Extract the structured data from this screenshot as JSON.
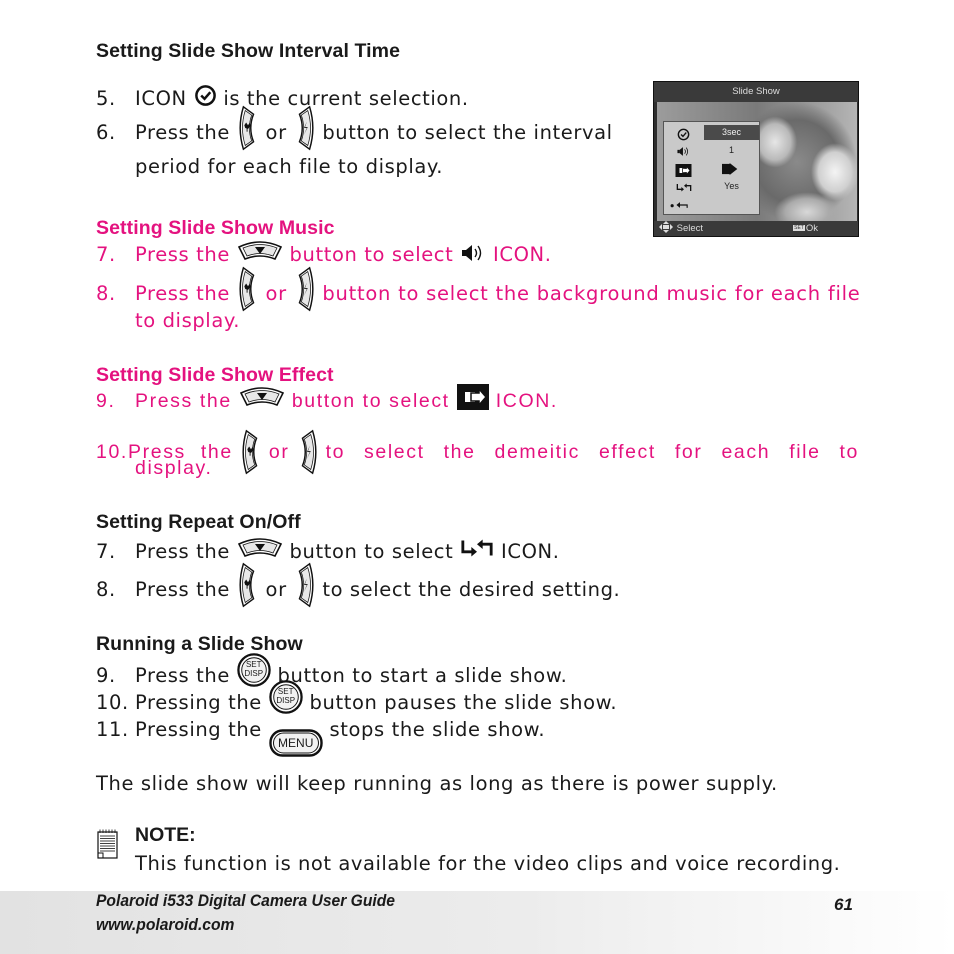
{
  "colors": {
    "accent_pink": "#e4127f",
    "text": "#1a1a1a"
  },
  "sections": {
    "interval": {
      "heading": "Setting Slide Show Interval Time",
      "steps": [
        {
          "num": "5.",
          "parts": [
            "ICON",
            "is the current selection."
          ],
          "icons": [
            "clock-icon"
          ]
        },
        {
          "num": "6.",
          "parts": [
            "Press the",
            "or",
            "button to select the interval"
          ],
          "continuation": "period for each file to display.",
          "icons": [
            "left-button-icon",
            "right-button-icon"
          ]
        }
      ]
    },
    "music": {
      "heading": "Setting Slide Show Music",
      "steps": [
        {
          "num": "7.",
          "parts": [
            "Press the",
            "button to select",
            "ICON."
          ],
          "icons": [
            "down-button-icon",
            "speaker-icon"
          ]
        },
        {
          "num": "8.",
          "parts": [
            "Press the",
            "or",
            "button to select the background music for each file"
          ],
          "continuation": "to display.",
          "icons": [
            "left-button-icon",
            "right-button-icon"
          ]
        }
      ]
    },
    "effect": {
      "heading": "Setting Slide Show Effect",
      "steps": [
        {
          "num": "9.",
          "parts": [
            "Press the",
            "button to select",
            "ICON."
          ],
          "icons": [
            "down-button-icon",
            "effect-icon"
          ]
        },
        {
          "num": "10.",
          "parts": [
            "Press the",
            "or",
            "to select the demeitic effect for each file to"
          ],
          "continuation": "display.",
          "icons": [
            "left-button-icon",
            "right-button-icon"
          ]
        }
      ]
    },
    "repeat": {
      "heading": "Setting Repeat On/Off",
      "steps": [
        {
          "num": "7.",
          "parts": [
            "Press the",
            "button to select",
            "ICON."
          ],
          "icons": [
            "down-button-icon",
            "repeat-icon"
          ]
        },
        {
          "num": "8.",
          "parts": [
            "Press the",
            "or",
            "to select the desired setting."
          ],
          "icons": [
            "left-button-icon",
            "right-button-icon"
          ]
        }
      ]
    },
    "running": {
      "heading": "Running a Slide Show",
      "steps": [
        {
          "num": "9.",
          "parts": [
            "Press the",
            "button to start a slide show."
          ],
          "icons": [
            "set-disp-button-icon"
          ]
        },
        {
          "num": "10.",
          "parts": [
            "Pressing the",
            "button pauses the slide show."
          ],
          "icons": [
            "set-disp-button-icon"
          ]
        },
        {
          "num": "11.",
          "parts": [
            "Pressing the",
            "stops the slide show."
          ],
          "icons": [
            "menu-button-icon"
          ]
        }
      ],
      "button_labels": {
        "set_top": "SET",
        "set_bottom": "DISP",
        "menu": "MENU"
      }
    }
  },
  "power_note": "The slide show will keep running as long as there is power supply.",
  "note": {
    "label": "NOTE:",
    "text": "This function is not available for the video clips and voice recording."
  },
  "camera_screen": {
    "title": "Slide Show",
    "rows": [
      {
        "icon": "clock-icon",
        "value": "3sec",
        "selected": true
      },
      {
        "icon": "speaker-icon",
        "value": "1",
        "selected": false
      },
      {
        "icon": "effect-icon",
        "value": "",
        "value_icon": "arrow-right-icon",
        "selected": false
      },
      {
        "icon": "repeat-icon",
        "value": "Yes",
        "selected": false
      },
      {
        "icon": "back-icon",
        "value": "",
        "selected": false
      }
    ],
    "bottom_left": "Select",
    "bottom_right": "Ok",
    "set_chip": "SET"
  },
  "footer": {
    "title": "Polaroid i533 Digital Camera User Guide",
    "url": "www.polaroid.com",
    "page": "61"
  }
}
